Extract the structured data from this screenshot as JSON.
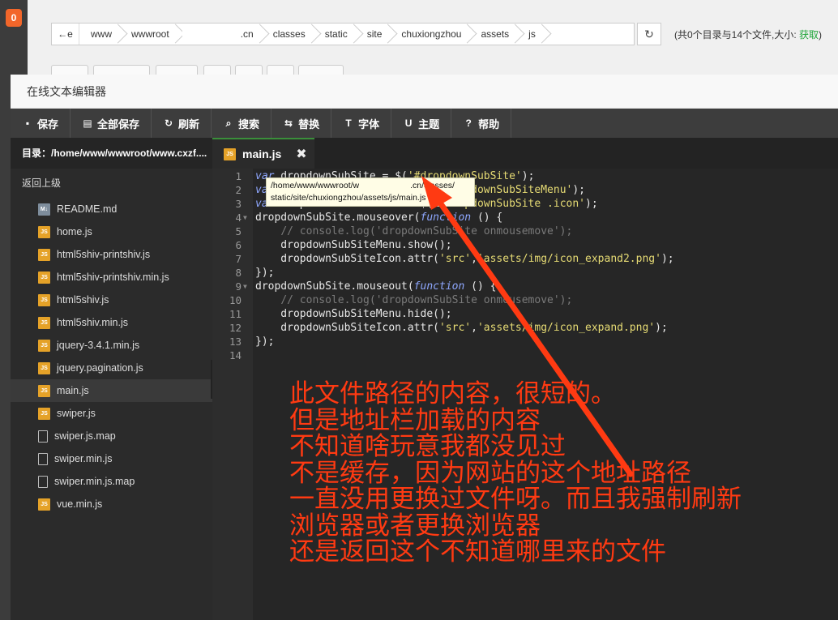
{
  "badge": "0",
  "breadcrumb": [
    "www",
    "wwwroot",
    "masked",
    "static",
    "site",
    "chuxiongzhou",
    "assets",
    "js"
  ],
  "breadcrumb_tail": ".cn",
  "breadcrumb_classes": "classes",
  "dir_info_prefix": "(共0个目录与14个文件,大小:",
  "dir_info_get": "获取",
  "dir_info_suffix": ")",
  "editor": {
    "title": "在线文本编辑器",
    "toolbar": [
      {
        "icon": "floppy-icon",
        "glyph": "▪",
        "label": "保存"
      },
      {
        "icon": "save-all-icon",
        "glyph": "▤",
        "label": "全部保存"
      },
      {
        "icon": "refresh-icon",
        "glyph": "↻",
        "label": "刷新"
      },
      {
        "icon": "search-icon",
        "glyph": "⌕",
        "label": "搜索"
      },
      {
        "icon": "replace-icon",
        "glyph": "⇆",
        "label": "替换"
      },
      {
        "icon": "font-icon",
        "glyph": "T",
        "label": "字体"
      },
      {
        "icon": "magnet-icon",
        "glyph": "U",
        "label": "主题"
      },
      {
        "icon": "help-icon",
        "glyph": "?",
        "label": "帮助"
      }
    ],
    "sidebar_head": "目录：/home/www/wwwroot/www.cxzf....",
    "back_up": "返回上级",
    "files": [
      {
        "name": "README.md",
        "type": "md"
      },
      {
        "name": "home.js",
        "type": "js"
      },
      {
        "name": "html5shiv-printshiv.js",
        "type": "js"
      },
      {
        "name": "html5shiv-printshiv.min.js",
        "type": "js"
      },
      {
        "name": "html5shiv.js",
        "type": "js"
      },
      {
        "name": "html5shiv.min.js",
        "type": "js"
      },
      {
        "name": "jquery-3.4.1.min.js",
        "type": "js"
      },
      {
        "name": "jquery.pagination.js",
        "type": "js"
      },
      {
        "name": "main.js",
        "type": "js",
        "active": true
      },
      {
        "name": "swiper.js",
        "type": "js"
      },
      {
        "name": "swiper.js.map",
        "type": "doc"
      },
      {
        "name": "swiper.min.js",
        "type": "doc"
      },
      {
        "name": "swiper.min.js.map",
        "type": "doc"
      },
      {
        "name": "vue.min.js",
        "type": "js"
      }
    ],
    "tab": {
      "label": "main.js",
      "icon_text": "JS"
    },
    "tooltip_lines": [
      "/home/www/wwwroot/w",
      ".cn/classes/",
      "static/site/chuxiongzhou/assets/js/main.js"
    ],
    "code_lines": [
      "var dropdownSubSite = $('#dropdownSubSite');",
      "var dropdownSubSiteMenu = $('#dropdownSubSiteMenu');",
      "var dropdownSubSiteIcon = $('#dropdownSubSite .icon');",
      "dropdownSubSite.mouseover(function () {",
      "    // console.log('dropdownSubSite onmousemove');",
      "    dropdownSubSiteMenu.show();",
      "    dropdownSubSiteIcon.attr('src','assets/img/icon_expand2.png');",
      "});",
      "dropdownSubSite.mouseout(function () {",
      "    // console.log('dropdownSubSite onmousemove');",
      "    dropdownSubSiteMenu.hide();",
      "    dropdownSubSiteIcon.attr('src','assets/img/icon_expand.png');",
      "});",
      ""
    ],
    "fold_lines": [
      4,
      9
    ]
  },
  "annotation": [
    "此文件路径的内容，很短的。",
    "但是地址栏加载的内容",
    "不知道啥玩意我都没见过",
    "不是缓存，因为网站的这个地址路径",
    "一直没用更换过文件呀。而且我强制刷新",
    "浏览器或者更换浏览器",
    "还是返回这个不知道哪里来的文件"
  ],
  "colors": {
    "annotation": "#ff3a12",
    "toolbar": "#3d3d3d",
    "get_link": "#20a53a",
    "js_icon": "#e5a228"
  }
}
